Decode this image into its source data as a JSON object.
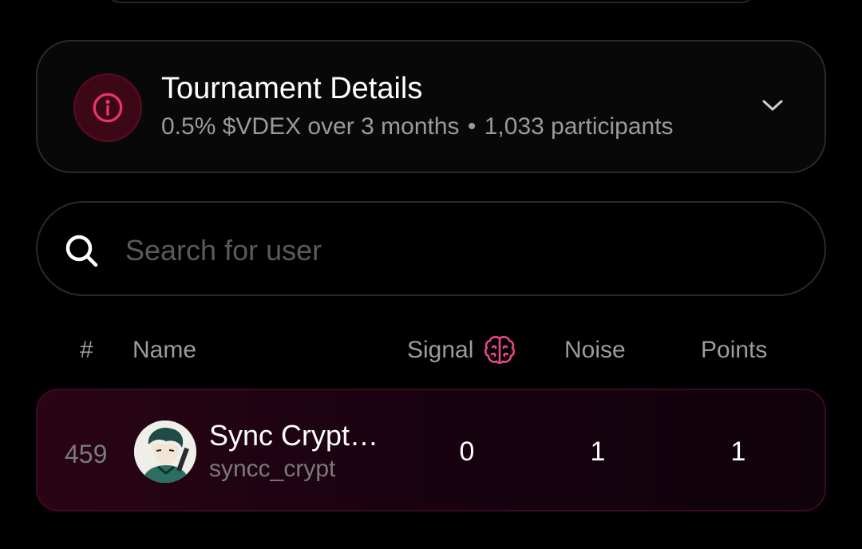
{
  "details": {
    "title": "Tournament Details",
    "subtitle_prize": "0.5% $VDEX over 3 months",
    "subtitle_separator": "•",
    "subtitle_participants": "1,033 participants",
    "icons": {
      "info": "info-icon",
      "expand": "chevron-down-icon"
    }
  },
  "search": {
    "placeholder": "Search for user",
    "value": "",
    "icon": "search-icon"
  },
  "table": {
    "headers": {
      "rank": "#",
      "name": "Name",
      "signal": "Signal",
      "signal_icon": "brain-icon",
      "noise": "Noise",
      "points": "Points"
    },
    "rows": [
      {
        "rank": "459",
        "display_name": "Sync Crypt…",
        "username": "syncc_crypt",
        "signal": "0",
        "noise": "1",
        "points": "1"
      }
    ]
  },
  "colors": {
    "accent": "#e8336f",
    "background": "#000000",
    "card_border": "#2a2a2a",
    "row_highlight": "#2a0414",
    "muted_text": "#9a9a9a"
  }
}
